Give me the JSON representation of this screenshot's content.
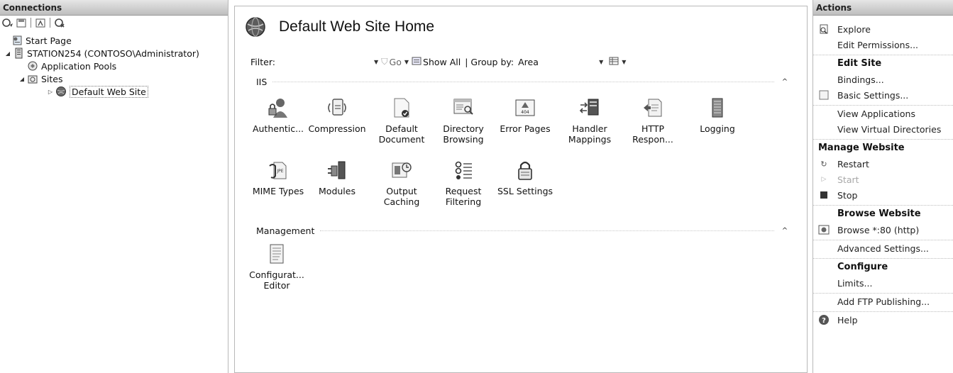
{
  "connections": {
    "title": "Connections",
    "tree": [
      {
        "label": "Start Page",
        "icon": "start-page-icon",
        "depth": 0,
        "expander": ""
      },
      {
        "label": "STATION254 (CONTOSO\\Administrator)",
        "icon": "server-icon",
        "depth": 0,
        "expander": "◢"
      },
      {
        "label": "Application Pools",
        "icon": "app-pools-icon",
        "depth": 1,
        "expander": ""
      },
      {
        "label": "Sites",
        "icon": "sites-folder-icon",
        "depth": 1,
        "expander": "◢"
      },
      {
        "label": "Default Web Site",
        "icon": "globe-icon",
        "depth": 2,
        "expander": "▷",
        "selected": true
      }
    ]
  },
  "center": {
    "title": "Default Web Site Home",
    "filter_label": "Filter:",
    "go_label": "Go",
    "show_all_label": "Show All",
    "group_by_label": "| Group by:",
    "group_by_value": "Area",
    "groups": {
      "iis": {
        "label": "IIS",
        "features": [
          {
            "label": "Authentic...",
            "icon": "authentication-icon"
          },
          {
            "label": "Compression",
            "icon": "compression-icon"
          },
          {
            "label": "Default\nDocument",
            "icon": "default-document-icon"
          },
          {
            "label": "Directory\nBrowsing",
            "icon": "directory-browsing-icon"
          },
          {
            "label": "Error Pages",
            "icon": "error-pages-icon"
          },
          {
            "label": "Handler\nMappings",
            "icon": "handler-mappings-icon"
          },
          {
            "label": "HTTP\nRespon...",
            "icon": "http-response-icon"
          },
          {
            "label": "Logging",
            "icon": "logging-icon"
          },
          {
            "label": "MIME Types",
            "icon": "mime-types-icon"
          },
          {
            "label": "Modules",
            "icon": "modules-icon"
          },
          {
            "label": "Output\nCaching",
            "icon": "output-caching-icon"
          },
          {
            "label": "Request\nFiltering",
            "icon": "request-filtering-icon"
          },
          {
            "label": "SSL Settings",
            "icon": "ssl-settings-icon"
          }
        ]
      },
      "management": {
        "label": "Management",
        "features": [
          {
            "label": "Configurat...\nEditor",
            "icon": "configuration-editor-icon"
          }
        ]
      }
    }
  },
  "actions": {
    "title": "Actions",
    "explore": "Explore",
    "edit_permissions": "Edit Permissions...",
    "edit_site": "Edit Site",
    "bindings": "Bindings...",
    "basic_settings": "Basic Settings...",
    "view_applications": "View Applications",
    "view_virtual_directories": "View Virtual Directories",
    "manage_website": "Manage Website",
    "restart": "Restart",
    "start": "Start",
    "stop": "Stop",
    "browse_website": "Browse Website",
    "browse_80": "Browse *:80 (http)",
    "advanced_settings": "Advanced Settings...",
    "configure": "Configure",
    "limits": "Limits...",
    "add_ftp_publishing": "Add FTP Publishing...",
    "help": "Help"
  }
}
